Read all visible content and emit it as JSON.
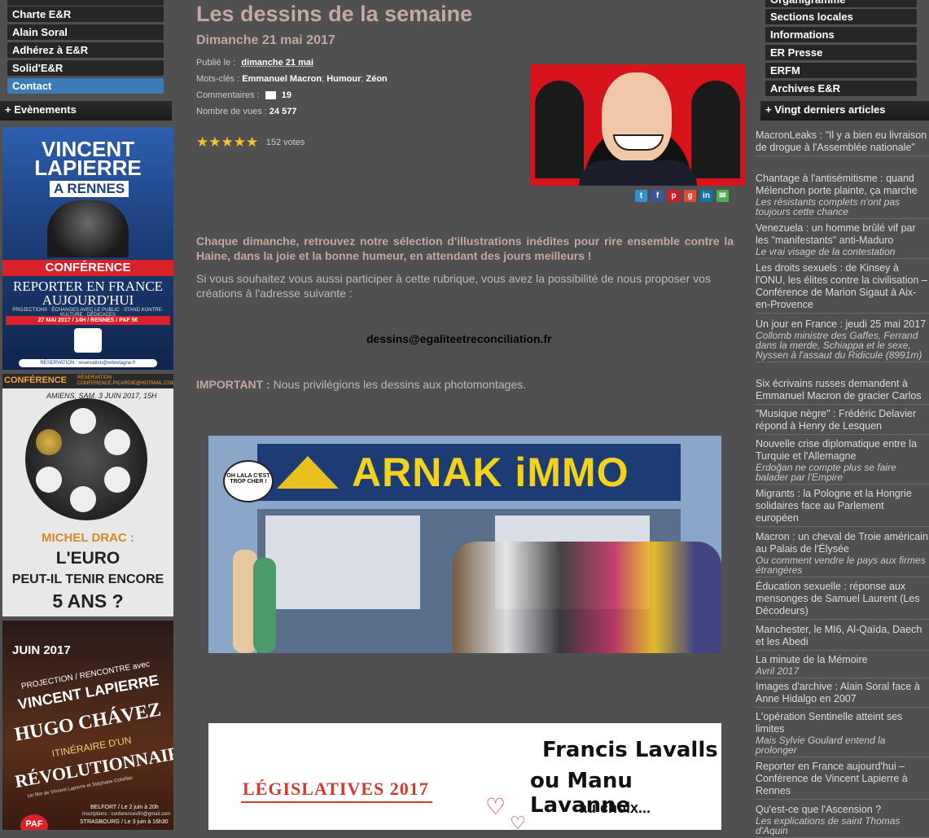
{
  "left_nav": {
    "items": [
      {
        "label": "Charte E&R",
        "active": false
      },
      {
        "label": "Alain Soral",
        "active": false
      },
      {
        "label": "Adhérez à E&R",
        "active": false
      },
      {
        "label": "Solid'E&R",
        "active": false
      },
      {
        "label": "Contact",
        "active": true
      }
    ],
    "events_header": "+ Evènements",
    "poster1": {
      "title_1": "VINCENT",
      "title_2": "LAPIERRE",
      "title_3": "A RENNES",
      "badge": "CONFÉRENCE",
      "subtitle_1": "REPORTER EN FRANCE",
      "subtitle_2": "AUJOURD'HUI",
      "info": "PROJECTIONS · ÉCHANGES AVEC LE PUBLIC · STAND KONTRE-KULTURE · DÉDICACES",
      "date": "27 MAI 2017 / 14H / RENNES / PAF 5€",
      "reservation": "RÉSERVATION : reservation@erbretagne.fr"
    },
    "poster2": {
      "badge": "CONFÉRENCE",
      "reservation": "RÉSERVATION : CONFERENCE.PICARDIE@HOTMAIL.COM",
      "date": "AMIENS, SAM. 3 JUIN 2017, 15H",
      "speaker": "MICHEL DRAC :",
      "line1": "L'EURO",
      "line2": "PEUT-IL TENIR ENCORE",
      "line3": "5 ANS ?"
    },
    "poster3": {
      "month": "JUIN 2017",
      "tagline": "PROJECTION / RENCONTRE avec",
      "name": "VINCENT LAPIERRE",
      "title": "HUGO CHÁVEZ",
      "sub1": "ITINÉRAIRE D'UN",
      "sub2": "RÉVOLUTIONNAIRE",
      "credits": "Un film de Vincent Lapierre et Stéphane Cohéllac",
      "city1": "BELFORT / Le 2 juin à 20h",
      "inscriptions": "Inscriptions : conferences90@gmail.com",
      "city2": "STRASBOURG / Le 3 juin à 16h30",
      "paf": "PAF"
    }
  },
  "main": {
    "title": "Les dessins de la semaine",
    "date": "Dimanche 21 mai 2017",
    "published_label": "Publié le :",
    "published_value": "dimanche 21 mai",
    "tags_label": "Mots-clés :",
    "tags": [
      "Emmanuel Macron",
      "Humour",
      "Zéon"
    ],
    "comments_label": "Commentaires :",
    "comments_value": "19",
    "views_label": "Nombre de vues :",
    "views_value": "24 577",
    "votes": "152 votes",
    "rating": 5,
    "intro": "Chaque dimanche, retrouvez notre sélection d'illustrations inédites pour rire ensemble contre la Haine, dans la joie et la bonne humeur, en attendant des jours meilleurs !",
    "paragraph": "Si vous souhaitez vous aussi participer à cette rubrique, vous avez la possibilité de nous proposer vos créations à l'adresse suivante :",
    "email": "dessins@egaliteetreconciliation.fr",
    "important_label": "IMPORTANT :",
    "important_text": " Nous privilégions les dessins aux photomontages.",
    "cartoon1": {
      "sign": "ARNAK iMMO",
      "bubble": "OH LALA C'EST TROP CHER !"
    },
    "cartoon2": {
      "title": "LÉGISLATIVES 2017",
      "caption1": "Francis Lavalls",
      "caption2": "ou Manu Lavanne",
      "caption3": "au choix..."
    },
    "share_icons": [
      "twitter-icon",
      "facebook-icon",
      "pinterest-icon",
      "googleplus-icon",
      "linkedin-icon",
      "email-icon"
    ]
  },
  "right_nav": {
    "items": [
      "Organigramme",
      "Sections locales",
      "Informations",
      "ER Presse",
      "ERFM",
      "Archives E&R"
    ],
    "articles_header": "+ Vingt derniers articles",
    "articles": [
      {
        "title": "MacronLeaks : \"Il y a bien eu livraison de drogue à l'Assemblée nationale\"",
        "sub": ""
      },
      {
        "title": "Chantage à l'antisémitisme : quand Mélenchon porte plainte, ça marche",
        "sub": "Les résistants complets n'ont pas toujours cette chance"
      },
      {
        "title": "Venezuela : un homme brûlé vif par les \"manifestants\" anti-Maduro",
        "sub": "Le vrai visage de la contestation"
      },
      {
        "title": "Les droits sexuels : de Kinsey à l'ONU, les élites contre la civilisation – Conférence de Marion Sigaut à Aix-en-Provence",
        "sub": ""
      },
      {
        "title": "Un jour en France : jeudi 25 mai 2017",
        "sub": "Collomb ministre des Gaffes, Ferrand dans la merde, Schiappa et le sexe, Nyssen à l'assaut du Ridicule (8991m)"
      },
      {
        "title": "Six écrivains russes demandent à Emmanuel Macron de gracier Carlos",
        "sub": ""
      },
      {
        "title": "\"Musique nègre\" : Frédéric Delavier répond à Henry de Lesquen",
        "sub": ""
      },
      {
        "title": "Nouvelle crise diplomatique entre la Turquie et l'Allemagne",
        "sub": "Erdoğan ne compte plus se faire balader par l'Empire"
      },
      {
        "title": "Migrants : la Pologne et la Hongrie solidaires face au Parlement européen",
        "sub": ""
      },
      {
        "title": "Macron : un cheval de Troie américain au Palais de l'Élysée",
        "sub": "Ou comment vendre le pays aux firmes étrangères"
      },
      {
        "title": "Éducation sexuelle : réponse aux mensonges de Samuel Laurent (Les Décodeurs)",
        "sub": ""
      },
      {
        "title": "Manchester, le MI6, Al-Qaïda, Daech et les Abedi",
        "sub": ""
      },
      {
        "title": "La minute de la Mémoire",
        "sub": "Avril 2017"
      },
      {
        "title": "Images d'archive : Alain Soral face à Anne Hidalgo en 2007",
        "sub": ""
      },
      {
        "title": "L'opération Sentinelle atteint ses limites",
        "sub": "Mais Sylvie Goulard entend la prolonger"
      },
      {
        "title": "Reporter en France aujourd'hui – Conférence de Vincent Lapierre à Rennes",
        "sub": ""
      },
      {
        "title": "Qu'est-ce que l'Ascension ?",
        "sub": "Les explications de saint Thomas d'Aquin"
      }
    ]
  }
}
